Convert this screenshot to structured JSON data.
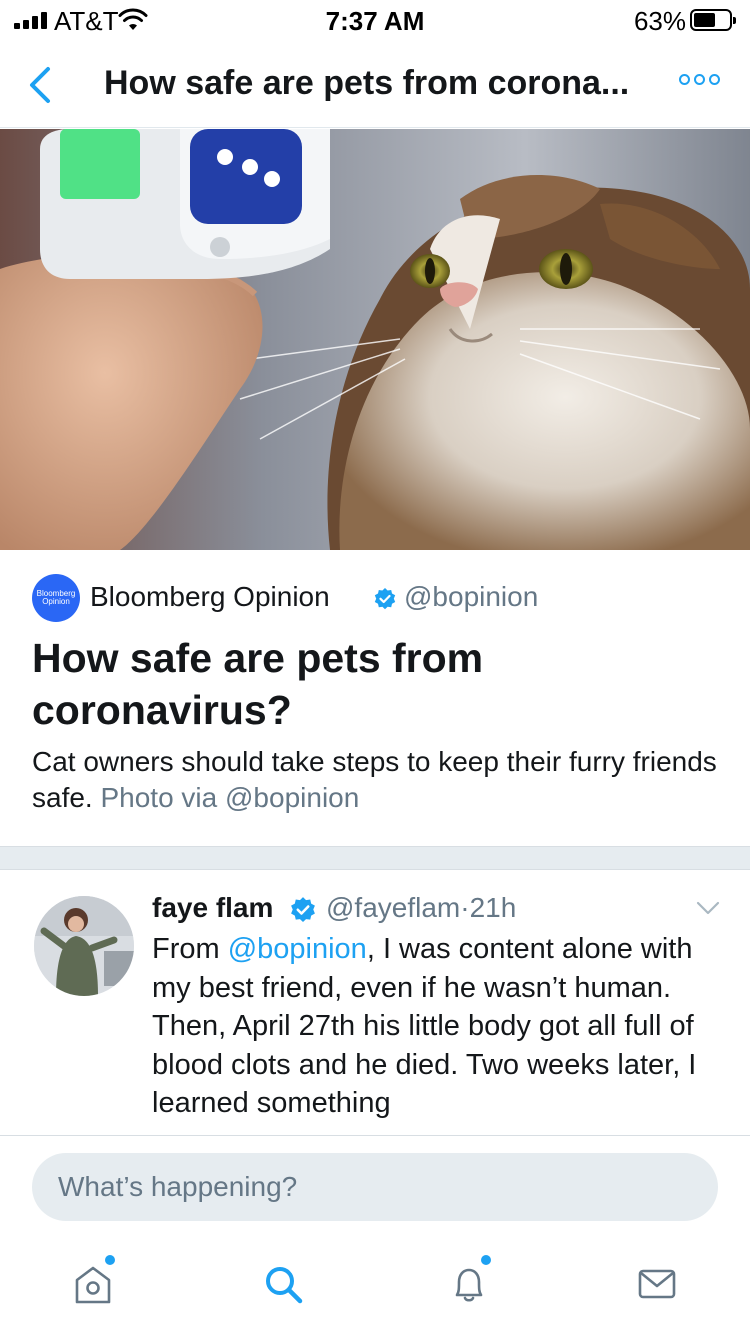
{
  "status_bar": {
    "carrier": "AT&T",
    "time": "7:37 AM",
    "battery_percent": "63%",
    "battery_level": 0.63,
    "icons": [
      "signal-icon",
      "wifi-icon",
      "battery-icon"
    ]
  },
  "nav": {
    "title": "How safe are pets from corona...",
    "back_icon": "chevron-left-icon",
    "more_icon": "more-icon"
  },
  "card": {
    "source_name": "Bloomberg Opinion",
    "source_handle": "@bopinion",
    "logo_text_line1": "Bloomberg",
    "logo_text_line2": "Opinion",
    "title": "How safe are pets from coronavirus?",
    "description": "Cat owners should take steps to keep their furry friends safe.",
    "photo_credit": "Photo via @bopinion"
  },
  "tweet": {
    "name": "faye flam",
    "handle": "@fayeflam",
    "separator": "·",
    "time": "21h",
    "body_prefix": "From ",
    "body_mention": "@bopinion",
    "body_text": ", I was content alone with my best friend, even if he wasn’t human. Then, April 27th his little body got all full of blood clots and he died. Two weeks later, I learned something"
  },
  "compose": {
    "placeholder": "What’s happening?"
  },
  "tabs": [
    {
      "name": "home",
      "icon": "home-icon",
      "has_dot": true
    },
    {
      "name": "search",
      "icon": "search-icon",
      "active": true
    },
    {
      "name": "notifications",
      "icon": "bell-icon",
      "has_dot": true
    },
    {
      "name": "messages",
      "icon": "mail-icon"
    }
  ],
  "colors": {
    "accent": "#1da1f2",
    "text": "#14171a",
    "muted": "#657786",
    "divider": "#e6ecf0",
    "bloomberg_blue": "#2a67f5"
  }
}
